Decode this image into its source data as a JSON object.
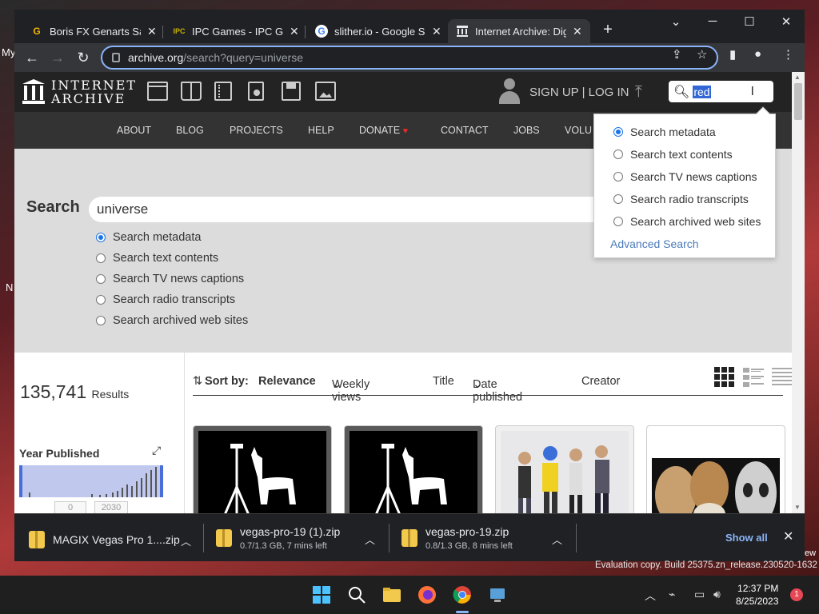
{
  "desktop": {
    "frag_my": "My",
    "frag_n": "N",
    "frag_ew": "ew"
  },
  "browser": {
    "tabs": [
      {
        "title": "Boris FX Genarts Sapphire",
        "favicon": "G"
      },
      {
        "title": "IPC Games - IPC Games",
        "favicon": "IPC"
      },
      {
        "title": "slither.io - Google Search",
        "favicon": "G"
      },
      {
        "title": "Internet Archive: Digital Library",
        "favicon": "ia"
      }
    ],
    "new_tab": "+",
    "address": {
      "host": "archive.org",
      "path": "/search?query=universe"
    }
  },
  "ia": {
    "logo_line1": "INTERNET",
    "logo_line2": "ARCHIVE",
    "signup": "SIGN UP | LOG IN",
    "header_search_value": "red",
    "nav": [
      "ABOUT",
      "BLOG",
      "PROJECTS",
      "HELP",
      "DONATE",
      "CONTACT",
      "JOBS",
      "VOLU"
    ],
    "search_label": "Search",
    "search_value": "universe",
    "search_options": [
      "Search metadata",
      "Search text contents",
      "Search TV news captions",
      "Search radio transcripts",
      "Search archived web sites"
    ],
    "selected_option": 0,
    "popup_options": [
      "Search metadata",
      "Search text contents",
      "Search TV news captions",
      "Search radio transcripts",
      "Search archived web sites"
    ],
    "advanced_search": "Advanced Search",
    "results_count": "135,741",
    "results_label": "Results",
    "year_published": "Year Published",
    "year_from": "0",
    "year_to": "2030",
    "sort_by": "Sort by:",
    "sort_options": [
      "Relevance",
      "Weekly views",
      "Title",
      "Date published",
      "Creator"
    ]
  },
  "downloads": [
    {
      "name": "MAGIX Vegas Pro 1....zip",
      "status": ""
    },
    {
      "name": "vegas-pro-19 (1).zip",
      "status": "0.7/1.3 GB, 7 mins left"
    },
    {
      "name": "vegas-pro-19.zip",
      "status": "0.8/1.3 GB, 8 mins left"
    }
  ],
  "show_all": "Show all",
  "evaluation": "Evaluation copy. Build 25375.zn_release.230520-1632",
  "clock": {
    "time": "12:37 PM",
    "date": "8/25/2023"
  },
  "notifications": "1",
  "colors": {
    "accent": "#8ab4f8",
    "ia_dark": "#232323",
    "link": "#4b7bba"
  }
}
